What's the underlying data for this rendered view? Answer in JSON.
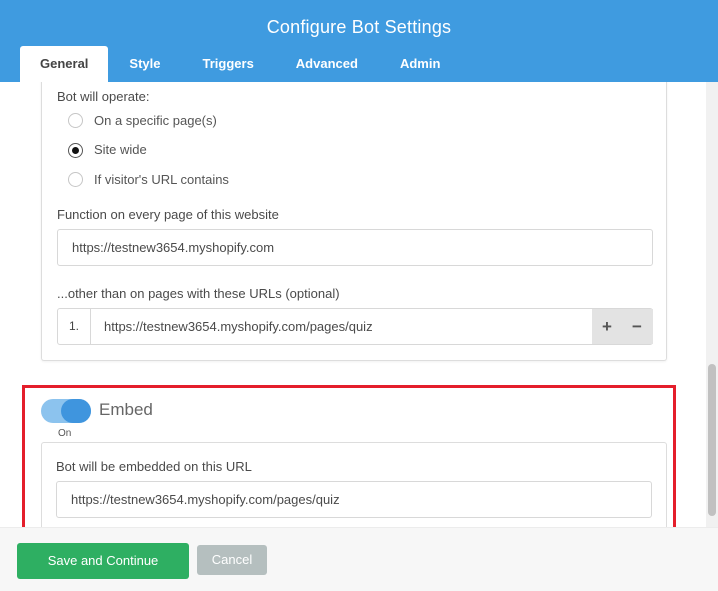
{
  "dialog": {
    "title": "Configure Bot Settings"
  },
  "tabs": [
    {
      "label": "General",
      "active": true
    },
    {
      "label": "Style",
      "active": false
    },
    {
      "label": "Triggers",
      "active": false
    },
    {
      "label": "Advanced",
      "active": false
    },
    {
      "label": "Admin",
      "active": false
    }
  ],
  "operate": {
    "heading": "Bot will operate:",
    "options": [
      {
        "label": "On a specific page(s)",
        "checked": false
      },
      {
        "label": "Site wide",
        "checked": true
      },
      {
        "label": "If visitor's URL contains",
        "checked": false
      }
    ]
  },
  "site_url": {
    "label": "Function on every page of this website",
    "value": "https://testnew3654.myshopify.com"
  },
  "exclusions": {
    "label": "...other than on pages with these URLs (optional)",
    "rows": [
      {
        "index": "1.",
        "value": "https://testnew3654.myshopify.com/pages/quiz"
      }
    ],
    "add_glyph": "+",
    "remove_glyph": "−"
  },
  "embed": {
    "label": "Embed",
    "enabled": true,
    "state_text": "On",
    "url_label": "Bot will be embedded on this URL",
    "url_value": "https://testnew3654.myshopify.com/pages/quiz"
  },
  "footer": {
    "save_label": "Save and Continue",
    "cancel_label": "Cancel"
  },
  "colors": {
    "header": "#3f9be0",
    "save": "#2eaf62",
    "cancel": "#b5bfbf",
    "highlight": "#e41e2b"
  }
}
